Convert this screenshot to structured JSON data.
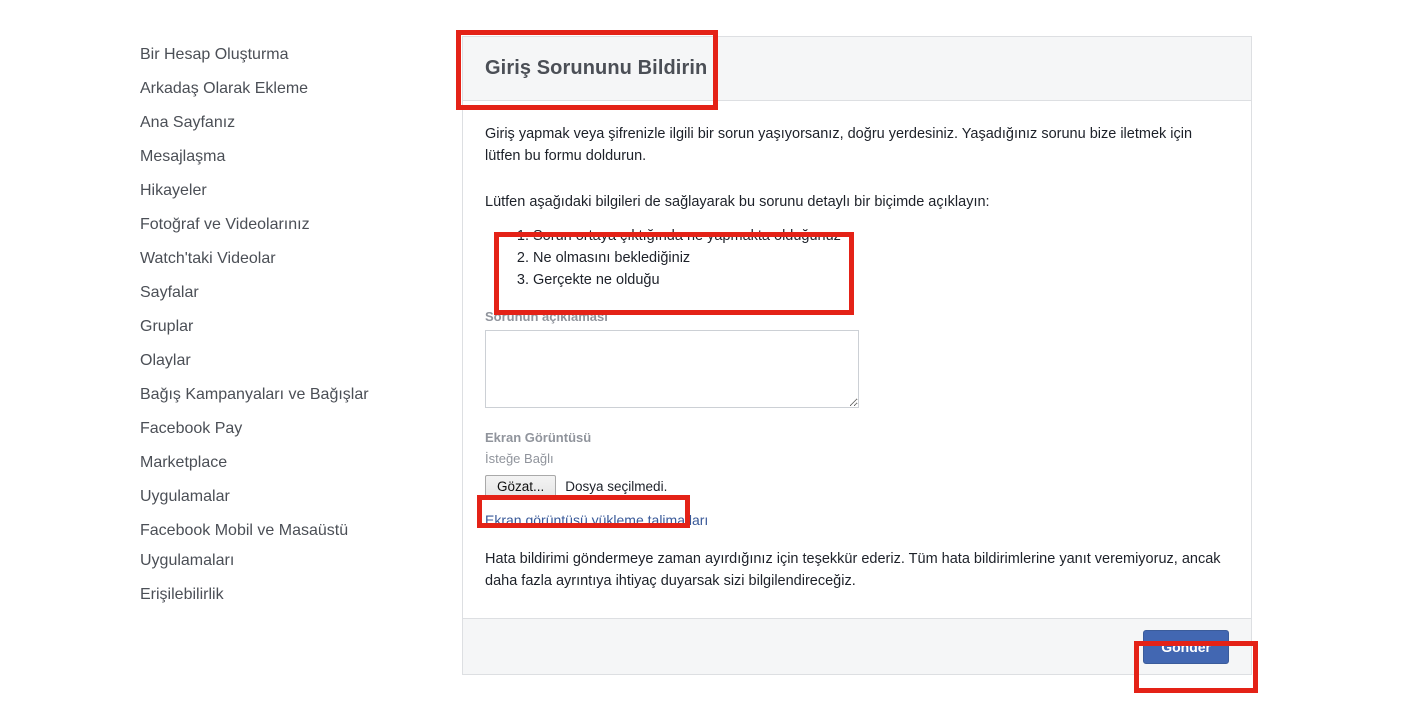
{
  "sidebar": {
    "items": [
      {
        "label": "Bir Hesap Oluşturma"
      },
      {
        "label": "Arkadaş Olarak Ekleme"
      },
      {
        "label": "Ana Sayfanız"
      },
      {
        "label": "Mesajlaşma"
      },
      {
        "label": "Hikayeler"
      },
      {
        "label": "Fotoğraf ve Videolarınız"
      },
      {
        "label": "Watch'taki Videolar"
      },
      {
        "label": "Sayfalar"
      },
      {
        "label": "Gruplar"
      },
      {
        "label": "Olaylar"
      },
      {
        "label": "Bağış Kampanyaları ve Bağışlar"
      },
      {
        "label": "Facebook Pay"
      },
      {
        "label": "Marketplace"
      },
      {
        "label": "Uygulamalar"
      },
      {
        "label": "Facebook Mobil ve Masaüstü Uygulamaları"
      },
      {
        "label": "Erişilebilirlik"
      }
    ]
  },
  "card": {
    "title": "Giriş Sorununu Bildirin",
    "intro": "Giriş yapmak veya şifrenizle ilgili bir sorun yaşıyorsanız, doğru yerdesiniz. Yaşadığınız sorunu bize iletmek için lütfen bu formu doldurun.",
    "instructions": "Lütfen aşağıdaki bilgileri de sağlayarak bu sorunu detaylı bir biçimde açıklayın:",
    "steps": [
      "Sorun ortaya çıktığında ne yapmakta olduğunuz",
      "Ne olmasını beklediğiniz",
      "Gerçekte ne olduğu"
    ],
    "description_label": "Sorunun açıklaması",
    "description_value": "",
    "description_placeholder": "",
    "screenshot_label": "Ekran Görüntüsü",
    "screenshot_optional": "İsteğe Bağlı",
    "browse_button": "Gözat...",
    "file_status": "Dosya seçilmedi.",
    "upload_link": "Ekran görüntüsü yükleme talimatları",
    "closing": "Hata bildirimi göndermeye zaman ayırdığınız için teşekkür ederiz. Tüm hata bildirimlerine yanıt veremiyoruz, ancak daha fazla ayrıntıya ihtiyaç duyarsak sizi bilgilendireceğiz.",
    "submit_button": "Gönder"
  },
  "colors": {
    "annotation_red": "#e42217",
    "submit_blue": "#4267b2",
    "link_blue": "#385898",
    "label_gray": "#90949c",
    "header_gray": "#f5f6f7"
  }
}
